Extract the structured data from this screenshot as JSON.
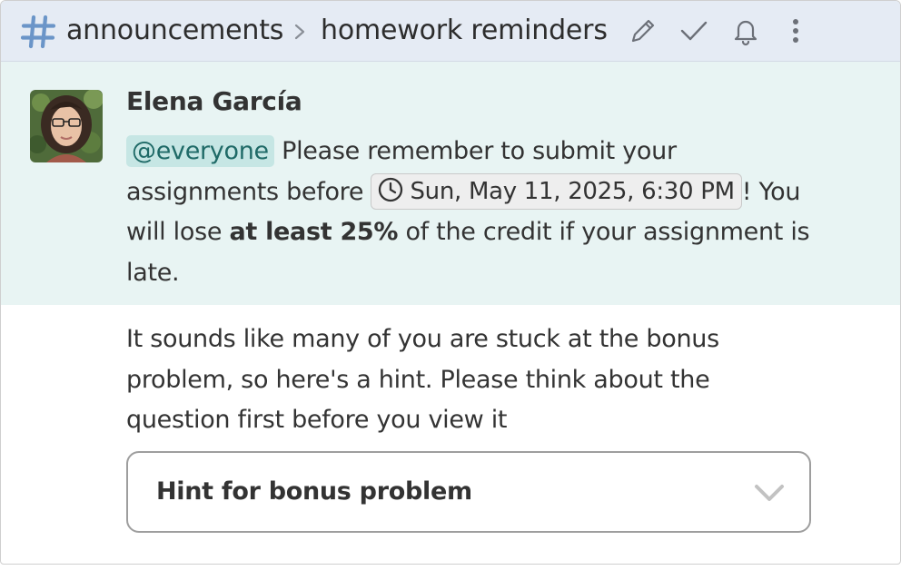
{
  "header": {
    "stream": "announcements",
    "topic": "homework reminders",
    "icons": [
      "hash-icon",
      "chevron-right-icon",
      "pencil-icon",
      "check-icon",
      "bell-icon",
      "more-vertical-icon"
    ]
  },
  "colors": {
    "header_bg": "#e5ebf4",
    "highlight_bg": "#e8f4f3",
    "mention_bg": "#c6e6e4",
    "mention_text": "#1f6a67",
    "hash_blue": "#6b95c8"
  },
  "message1": {
    "sender": "Elena García",
    "mention": "@everyone",
    "text_1": " Please remember to submit your assignments before ",
    "timestamp": "Sun, May 11, 2025, 6:30 PM",
    "text_2": "! You will lose ",
    "bold": "at least 25%",
    "text_3": " of the credit if your assignment is late."
  },
  "message2": {
    "text": "It sounds like many of you are stuck at the bonus problem, so here's a hint. Please think about the question first before you view it",
    "spoiler_title": "Hint for bonus problem"
  }
}
